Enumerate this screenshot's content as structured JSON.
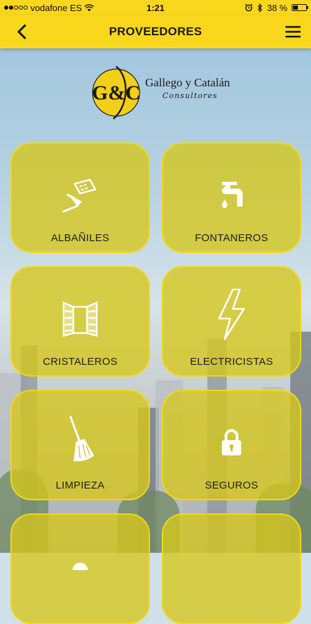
{
  "status_bar": {
    "carrier": "vodafone ES",
    "time": "1:21",
    "battery": "38 %",
    "battery_level": 0.38
  },
  "nav": {
    "title": "PROVEEDORES",
    "back_icon": "chevron-left-icon",
    "menu_icon": "hamburger-menu-icon"
  },
  "logo": {
    "monogram": "G&C",
    "name": "Gallego y Catalán",
    "subtitle": "Consultores"
  },
  "categories": [
    {
      "label": "ALBAÑILES",
      "icon": "trowel-brick-icon"
    },
    {
      "label": "FONTANEROS",
      "icon": "faucet-icon"
    },
    {
      "label": "CRISTALEROS",
      "icon": "window-icon"
    },
    {
      "label": "ELECTRICISTAS",
      "icon": "lightning-bolt-icon"
    },
    {
      "label": "LIMPIEZA",
      "icon": "broom-icon"
    },
    {
      "label": "SEGUROS",
      "icon": "padlock-icon"
    },
    {
      "label": "",
      "icon": "unknown-icon"
    },
    {
      "label": "",
      "icon": "unknown-icon"
    }
  ],
  "colors": {
    "brand_yellow": "#f9d71c",
    "tile_fill": "#d6c618",
    "text_dark": "#1f1f1f"
  }
}
